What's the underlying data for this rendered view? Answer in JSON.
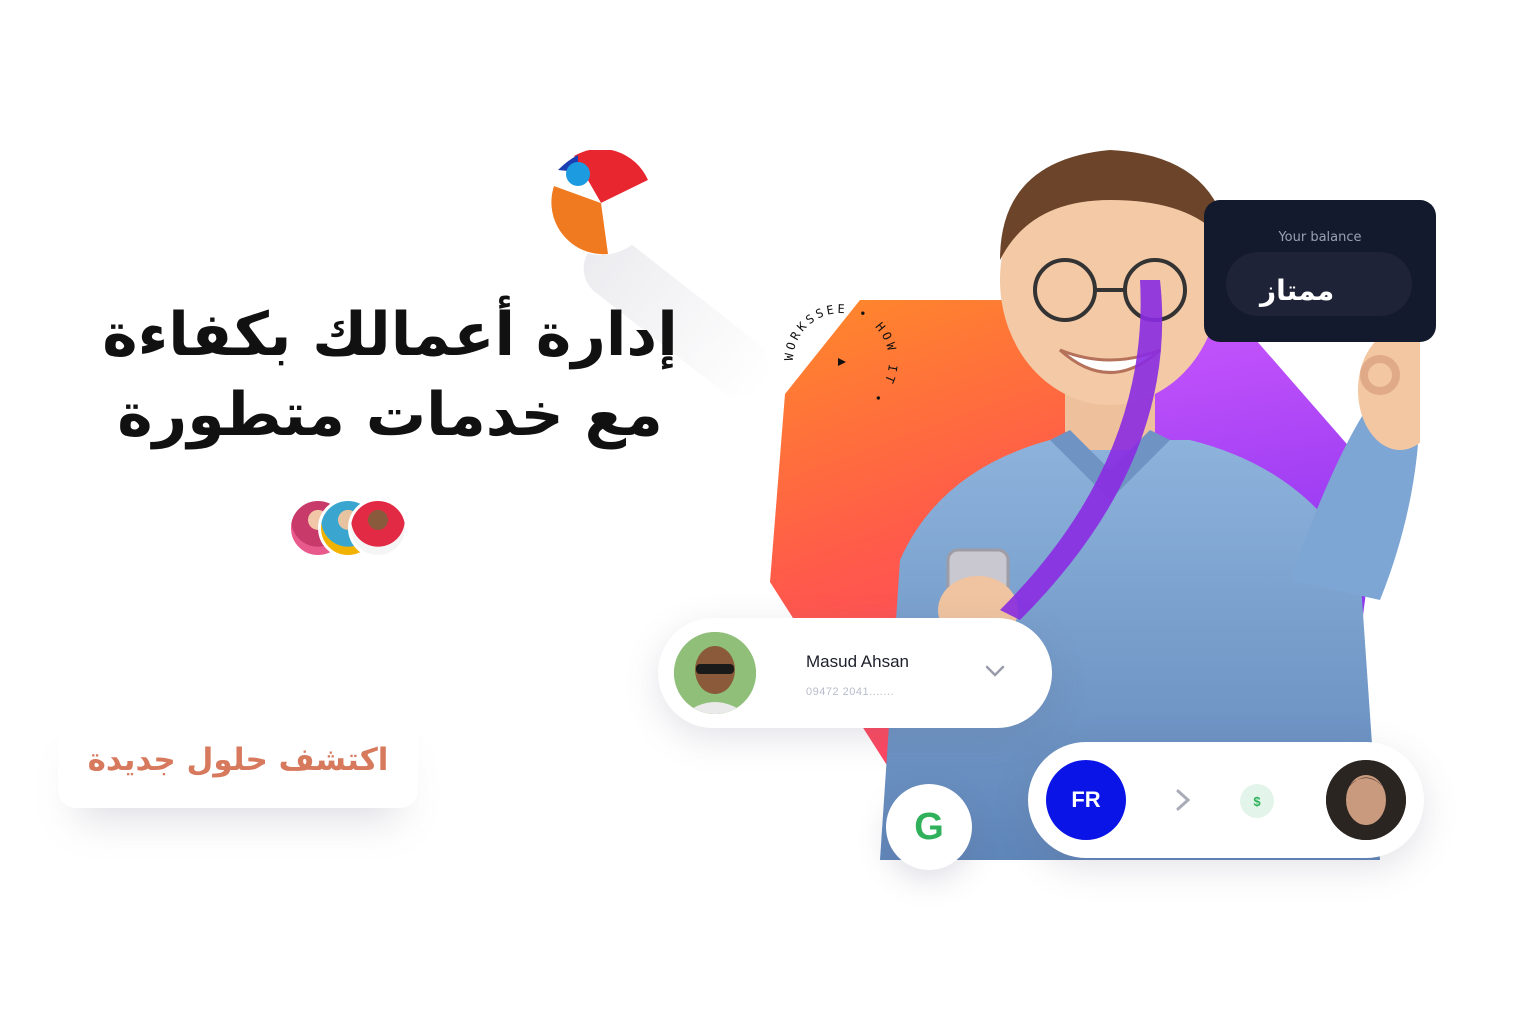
{
  "hero": {
    "headline_line1": "إدارة أعمالك بكفاءة",
    "headline_line2": "مع خدمات متطورة",
    "cta_label": "اكتشف حلول جديدة"
  },
  "balance_card": {
    "label": "Your balance",
    "value": "ممتاز"
  },
  "user_card": {
    "name": "Masud Ahsan",
    "phone": "09472 2041......."
  },
  "g_badge": {
    "letter": "G"
  },
  "transfer_card": {
    "sender_initials": "FR",
    "currency_symbol": "$"
  },
  "circle_badge": {
    "text": "WORKSSEE • HOW IT • "
  },
  "icons": {
    "ball": "beach-ball-icon",
    "chevron": "chevron-down-icon",
    "arrow": "chevron-right-icon"
  },
  "colors": {
    "headline": "#111111",
    "cta_text": "#d6795c",
    "balance_bg": "#141a2e",
    "fr_blue": "#0a14e6",
    "google_green": "#2fb05a",
    "orange_accent": "#ff5a4a",
    "purple_accent": "#9b3cf2"
  }
}
